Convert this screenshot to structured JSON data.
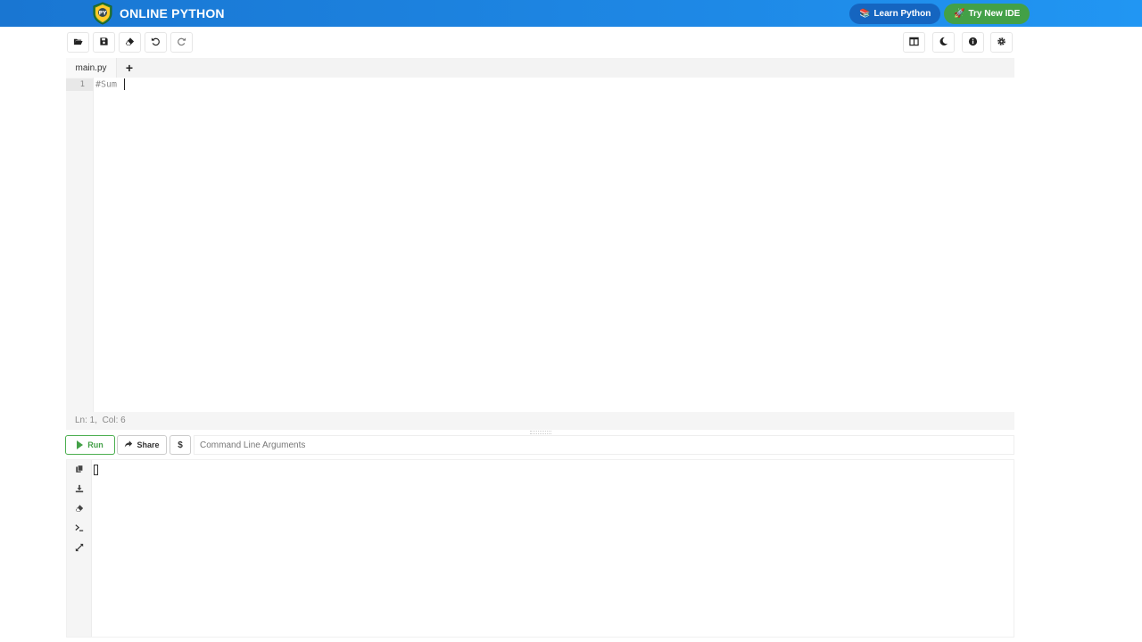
{
  "header": {
    "brand": "ONLINE PYTHON",
    "learn_label": "Learn Python",
    "try_label": "Try New IDE",
    "colors": {
      "nav_blue": "#1e88e5",
      "learn_bg": "#1565c0",
      "try_bg": "#43a047"
    }
  },
  "toolbar": {
    "left_icons": [
      "folder-open-icon",
      "save-icon",
      "eraser-icon",
      "undo-icon",
      "redo-icon"
    ],
    "right_icons": [
      "layout-columns-icon",
      "dark-mode-moon-icon",
      "info-icon",
      "settings-gear-icon"
    ]
  },
  "editor": {
    "tab_label": "main.py",
    "add_tab_symbol": "+",
    "line_number": "1",
    "code": "#Sum ",
    "status": "Ln: 1,  Col: 6"
  },
  "actions": {
    "run_label": "Run",
    "share_label": "Share",
    "dollar_label": "$",
    "cmd_placeholder": "Command Line Arguments",
    "run_color": "#43a047"
  },
  "terminal": {
    "side_icons": [
      "copy-icon",
      "download-icon",
      "eraser-icon",
      "terminal-prompt-icon",
      "expand-icon"
    ]
  }
}
